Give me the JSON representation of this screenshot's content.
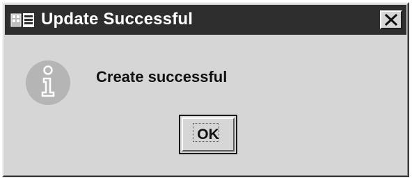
{
  "window": {
    "title": "Update Successful",
    "icon": "app-window-icon",
    "close_icon": "close-icon"
  },
  "message": {
    "icon": "info-icon",
    "text": "Create successful"
  },
  "buttons": {
    "ok_label": "OK"
  }
}
